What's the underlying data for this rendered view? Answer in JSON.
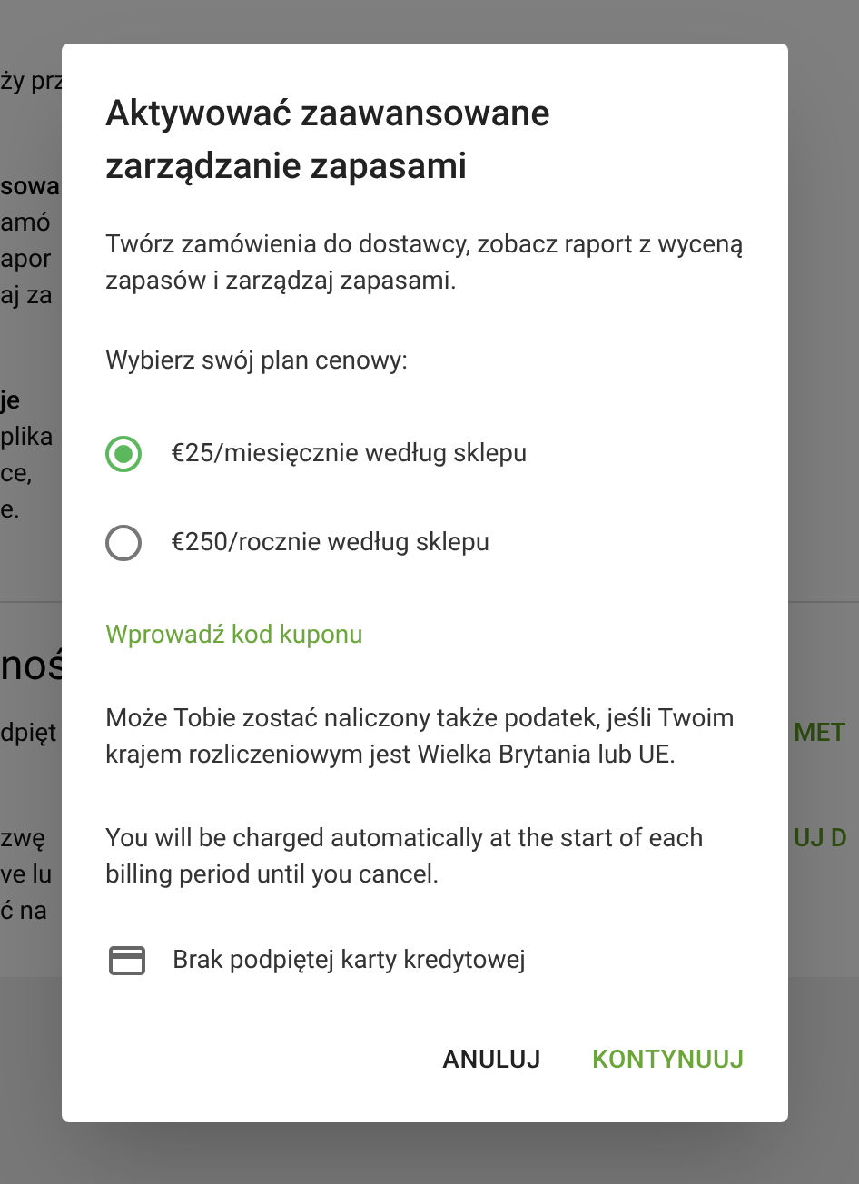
{
  "background": {
    "top_left": [
      "ży prz"
    ],
    "blocks": [
      {
        "title": "sowa",
        "lines": [
          "amó",
          "apor",
          "aj za"
        ]
      },
      {
        "title": "je",
        "lines": [
          "plika",
          "ce,",
          "e."
        ]
      }
    ],
    "section_heading": "noś",
    "rows": [
      {
        "lines": [
          "dpięt"
        ],
        "action": "MET"
      },
      {
        "lines": [
          "zwę",
          "ve lu",
          "ć na"
        ],
        "action": "UJ D"
      }
    ]
  },
  "dialog": {
    "title": "Aktywować zaawansowane zarządzanie zapasami",
    "description": "Twórz zamówienia do dostawcy, zobacz raport z wyceną zapasów i zarządzaj zapasami.",
    "plan_prompt": "Wybierz swój plan cenowy:",
    "plans": [
      {
        "label": "€25/miesięcznie według sklepu",
        "selected": true
      },
      {
        "label": "€250/rocznie według sklepu",
        "selected": false
      }
    ],
    "coupon_link": "Wprowadź kod kuponu",
    "tax_note": "Może Tobie zostać naliczony także podatek, jeśli Twoim krajem rozliczeniowym jest Wielka Brytania lub UE.",
    "billing_note": "You will be charged automatically at the start of each billing period until you cancel.",
    "card_status": "Brak podpiętej karty kredytowej",
    "buttons": [
      {
        "label": "ANULUJ",
        "kind": "secondary"
      },
      {
        "label": "KONTYNUUJ",
        "kind": "primary"
      }
    ]
  }
}
